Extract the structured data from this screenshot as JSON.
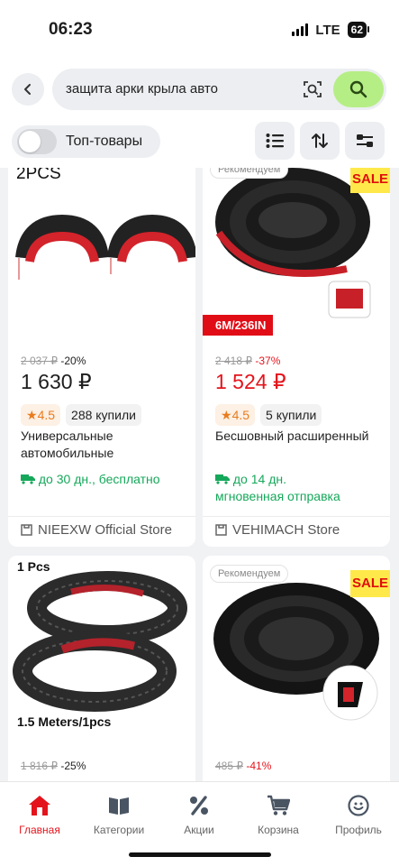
{
  "status": {
    "time": "06:23",
    "network": "LTE",
    "battery": "62"
  },
  "search": {
    "query": "защита арки крыла авто"
  },
  "filters": {
    "top_products": "Топ-товары"
  },
  "products": [
    {
      "image_caption": "2PCS",
      "old_price": "2 037 ₽",
      "discount": "-20%",
      "price": "1 630 ₽",
      "rating": "4.5",
      "bought": "288 купили",
      "title": "Универсальные автомобильные",
      "delivery": "до 30 дн., бесплатно",
      "store": "NIEEXW Official Store"
    },
    {
      "recommend_badge": "Рекомендуем",
      "sale_badge": "SALE",
      "length_badge": "6M/236IN",
      "old_price": "2 418 ₽",
      "discount": "-37%",
      "price": "1 524 ₽",
      "rating": "4.5",
      "bought": "5 купили",
      "title": "Бесшовный расширенный",
      "delivery_line1": "до 14 дн.",
      "delivery_line2": "мгновенная отправка",
      "store": "VEHIMACH Store"
    },
    {
      "caption_top": "1 Pcs",
      "caption_bottom": "1.5 Meters/1pcs",
      "old_price": "1 816 ₽",
      "discount": "-25%"
    },
    {
      "recommend_badge": "Рекомендуем",
      "sale_badge": "SALE",
      "old_price": "485 ₽",
      "discount": "-41%"
    }
  ],
  "tabbar": [
    {
      "label": "Главная",
      "icon": "home-icon",
      "active": true
    },
    {
      "label": "Категории",
      "icon": "catalog-icon"
    },
    {
      "label": "Акции",
      "icon": "percent-icon"
    },
    {
      "label": "Корзина",
      "icon": "cart-icon"
    },
    {
      "label": "Профиль",
      "icon": "profile-icon"
    }
  ],
  "colors": {
    "accent_red": "#e4141c",
    "search_green": "#b6ee86",
    "delivery_green": "#15a85a",
    "rating_orange": "#e87c1e",
    "sale_yellow": "#ffe94a"
  }
}
